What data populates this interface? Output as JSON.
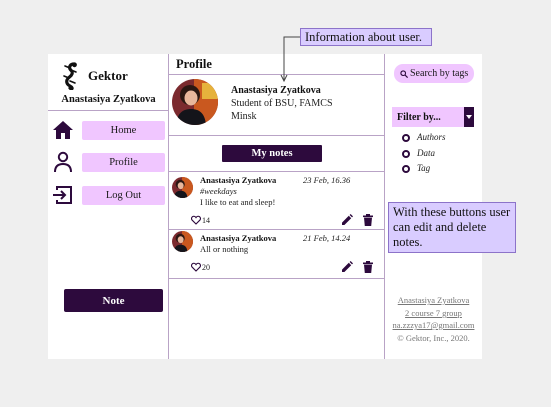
{
  "sidebar": {
    "app_name": "Gektor",
    "user_name": "Anastasiya Zyatkova",
    "items": [
      {
        "label": "Home",
        "icon": "home-icon"
      },
      {
        "label": "Profile",
        "icon": "person-icon"
      },
      {
        "label": "Log Out",
        "icon": "logout-icon"
      }
    ],
    "note_button": "Note"
  },
  "main": {
    "title": "Profile",
    "profile": {
      "name": "Anastasiya Zyatkova",
      "line1": "Student of BSU, FAMCS",
      "line2": "Minsk"
    },
    "my_notes_button": "My notes",
    "notes": [
      {
        "author": "Anastasiya Zyatkova",
        "date": "23 Feb, 16.36",
        "tag": "#weekdays",
        "text": "I like to eat and sleep!",
        "likes": "14"
      },
      {
        "author": "Anastasiya Zyatkova",
        "date": "21 Feb, 14.24",
        "tag": "",
        "text": "All or nothing",
        "likes": "20"
      }
    ]
  },
  "right": {
    "search_label": "Search by tags",
    "filter_label": "Filter by...",
    "filter_options": [
      "Authors",
      "Data",
      "Tag"
    ],
    "footer": {
      "name": "Anastasiya Zyatkova",
      "group": "2 course 7 group",
      "email": "na.zzzya17@gmail.com",
      "copyright": "© Gektor, Inc., 2020."
    }
  },
  "callouts": {
    "user_info": "Information about user.",
    "note_buttons": "With these buttons user can edit and delete notes."
  },
  "colors": {
    "accent_light": "#f0c6ff",
    "accent_dark": "#2d0a3d",
    "divider": "#b9a3c6",
    "callout_bg": "#d9ccff"
  }
}
